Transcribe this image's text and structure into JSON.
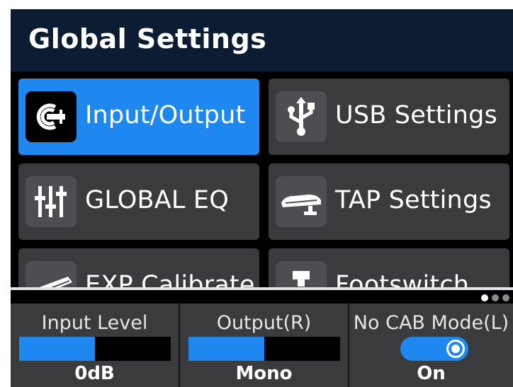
{
  "header": {
    "title": "Global Settings"
  },
  "tiles": [
    {
      "label": "Input/Output",
      "icon": "input-output-icon",
      "selected": true
    },
    {
      "label": "USB Settings",
      "icon": "usb-icon",
      "selected": false
    },
    {
      "label": "GLOBAL EQ",
      "icon": "eq-sliders-icon",
      "selected": false
    },
    {
      "label": "TAP Settings",
      "icon": "tap-pedal-icon",
      "selected": false
    },
    {
      "label": "EXP Calibrate",
      "icon": "expression-pedal-icon",
      "selected": false
    },
    {
      "label": "Footswitch",
      "icon": "footswitch-icon",
      "selected": false
    }
  ],
  "pagination": {
    "pages": 3,
    "current": 1
  },
  "footer": {
    "input_level": {
      "label": "Input Level",
      "value": "0dB",
      "fill": 0.5
    },
    "output": {
      "label": "Output(R)",
      "value": "Mono",
      "fill": 0.5
    },
    "no_cab_mode": {
      "label": "No CAB Mode(L)",
      "value": "On",
      "enabled": true
    }
  },
  "colors": {
    "accent": "#1f87f0",
    "header_bg": "#0b1c33",
    "tile_bg": "#3a3b3d"
  }
}
